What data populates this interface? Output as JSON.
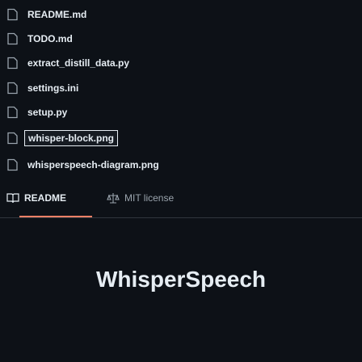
{
  "files": [
    {
      "name": "README.md"
    },
    {
      "name": "TODO.md"
    },
    {
      "name": "extract_distill_data.py"
    },
    {
      "name": "settings.ini"
    },
    {
      "name": "setup.py"
    },
    {
      "name": "whisper-block.png"
    },
    {
      "name": "whisperspeech-diagram.png"
    }
  ],
  "tabs": {
    "readme": "README",
    "license": "MIT license"
  },
  "readme": {
    "title": "WhisperSpeech"
  }
}
